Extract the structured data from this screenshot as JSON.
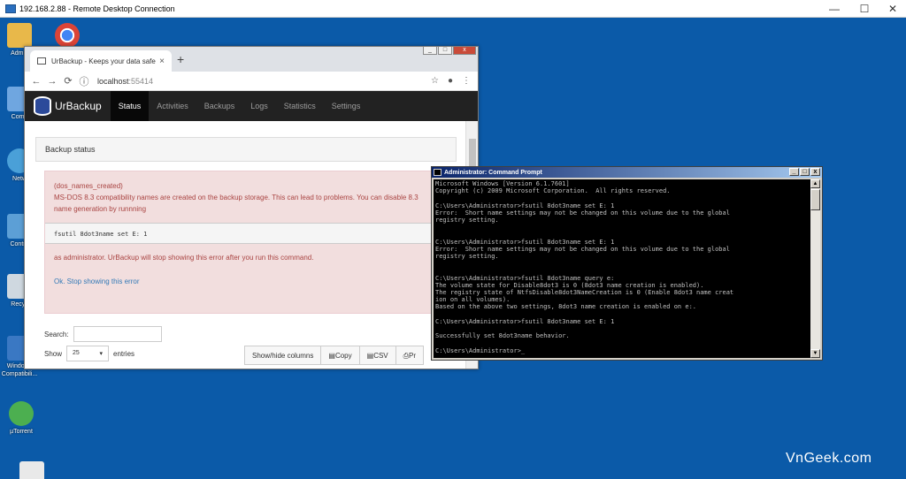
{
  "rdp": {
    "title": "192.168.2.88 - Remote Desktop Connection",
    "minimize": "—",
    "maximize": "☐",
    "close": "✕"
  },
  "desktop_icons": [
    {
      "label": "Admin",
      "icon": "folder-icon",
      "color": "#e8b84a"
    },
    {
      "label": "",
      "icon": "chrome-icon",
      "color": "#db4437"
    },
    {
      "label": "Comp",
      "icon": "computer-icon",
      "color": "#6fa6e0"
    },
    {
      "label": "Netw",
      "icon": "network-icon",
      "color": "#4aa0d8"
    },
    {
      "label": "Contro",
      "icon": "control-panel-icon",
      "color": "#5c9fd6"
    },
    {
      "label": "Recyc",
      "icon": "recycle-bin-icon",
      "color": "#cfd8e0"
    },
    {
      "label": "Windows Compatibili...",
      "icon": "windows-compat-icon",
      "color": "#3a78c3"
    },
    {
      "label": "µTorrent",
      "icon": "utorrent-icon",
      "color": "#4caf50"
    }
  ],
  "browser": {
    "tab_title": "UrBackup - Keeps your data safe",
    "tab_close": "×",
    "new_tab": "+",
    "back": "←",
    "forward": "→",
    "reload": "⟳",
    "info": "ⓘ",
    "url_host": "localhost",
    "url_port": ":55414",
    "star": "☆",
    "account": "●",
    "menu": "⋮"
  },
  "urbackup": {
    "brand": "UrBackup",
    "nav": [
      "Status",
      "Activities",
      "Backups",
      "Logs",
      "Statistics",
      "Settings"
    ],
    "panel_title": "Backup status",
    "alert_code": "(dos_names_created)",
    "alert_text": "MS-DOS 8.3 compatibility names are created on the backup storage. This can lead to problems. You can disable 8.3 name generation by runnning",
    "alert_command": "fsutil 8dot3name set E: 1",
    "alert_after": "as administrator. UrBackup will stop showing this error after you run this command.",
    "alert_link": "Ok. Stop showing this error",
    "search_label": "Search:",
    "show_label": "Show",
    "show_value": "25",
    "entries_label": "entries",
    "buttons": [
      "Show/hide columns",
      "Copy",
      "CSV",
      "Pr"
    ]
  },
  "cmd": {
    "title": "Administrator: Command Prompt",
    "lines": [
      "Microsoft Windows [Version 6.1.7601]",
      "Copyright (c) 2009 Microsoft Corporation.  All rights reserved.",
      "",
      "C:\\Users\\Administrator>fsutil 8dot3name set E: 1",
      "Error:  Short name settings may not be changed on this volume due to the global",
      "registry setting.",
      "",
      "",
      "C:\\Users\\Administrator>fsutil 8dot3name set E: 1",
      "Error:  Short name settings may not be changed on this volume due to the global",
      "registry setting.",
      "",
      "",
      "C:\\Users\\Administrator>fsutil 8dot3name query e:",
      "The volume state for Disable8dot3 is 0 (8dot3 name creation is enabled).",
      "The registry state of NtfsDisable8dot3NameCreation is 0 (Enable 8dot3 name creat",
      "ion on all volumes).",
      "Based on the above two settings, 8dot3 name creation is enabled on e:.",
      "",
      "C:\\Users\\Administrator>fsutil 8dot3name set E: 1",
      "",
      "Successfully set 8dot3name behavior.",
      "",
      "C:\\Users\\Administrator>_"
    ]
  },
  "watermark": "VnGeek.com"
}
